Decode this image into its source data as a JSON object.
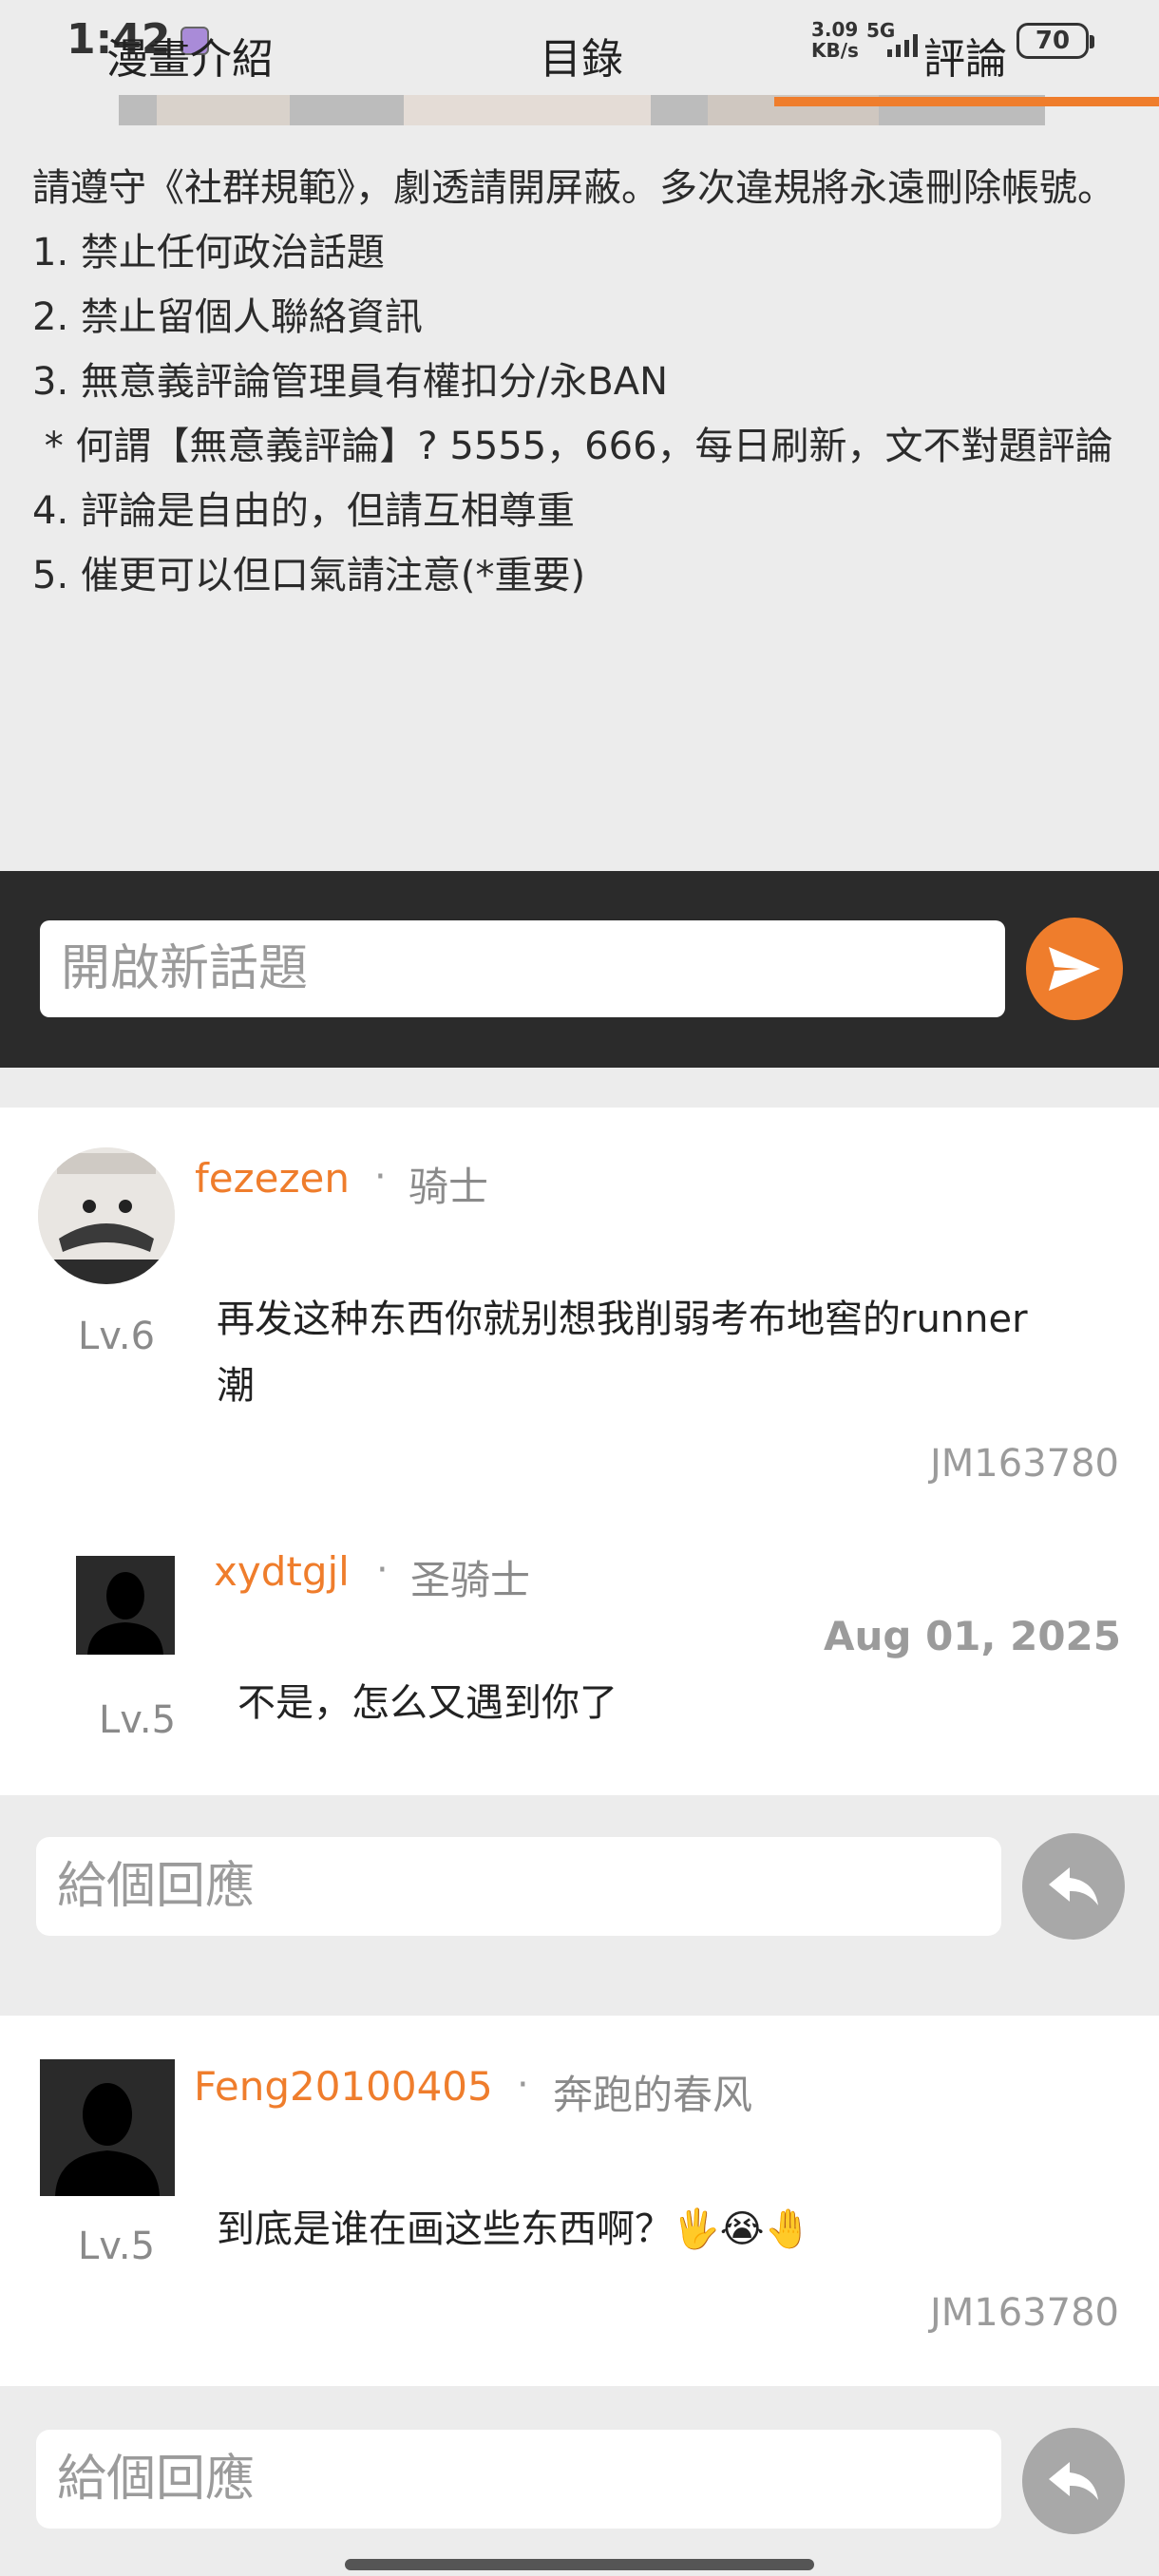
{
  "status_bar": {
    "time": "1:42",
    "speed_value": "3.09",
    "speed_unit": "KB/s",
    "network": "5G",
    "battery": "70"
  },
  "tabs": [
    {
      "label": "漫畫介紹"
    },
    {
      "label": "目錄"
    },
    {
      "label": "評論",
      "active": true
    }
  ],
  "accent_color": "#ef7d2c",
  "rules": [
    "請遵守《社群規範》，劇透請開屏蔽。多次違規將永遠刪除帳號。",
    "1. 禁止任何政治話題",
    "2. 禁止留個人聯絡資訊",
    "3. 無意義評論管理員有權扣分/永BAN",
    " * 何謂【無意義評論】? 5555，666，每日刷新，文不對題評論",
    "4. 評論是自由的，但請互相尊重",
    "5. 催更可以但口氣請注意(*重要)"
  ],
  "new_topic": {
    "placeholder": "開啟新話題",
    "icon": "send-icon"
  },
  "comments": [
    {
      "username": "fezezen",
      "rank": "骑士",
      "level": "Lv.6",
      "text": "再发这种东西你就别想我削弱考布地窖的runner潮",
      "id": "JM163780",
      "reply": {
        "username": "xydtgjl",
        "rank": "圣骑士",
        "level": "Lv.5",
        "date": "Aug 01, 2025",
        "text": "不是，怎么又遇到你了"
      },
      "reply_box": {
        "placeholder": "給個回應",
        "icon": "reply-icon"
      }
    },
    {
      "username": "Feng20100405",
      "rank": "奔跑的春风",
      "level": "Lv.5",
      "text": "到底是谁在画这些东西啊？🖐😭🤚",
      "id": "JM163780",
      "reply_box": {
        "placeholder": "給個回應",
        "icon": "reply-icon"
      }
    }
  ]
}
